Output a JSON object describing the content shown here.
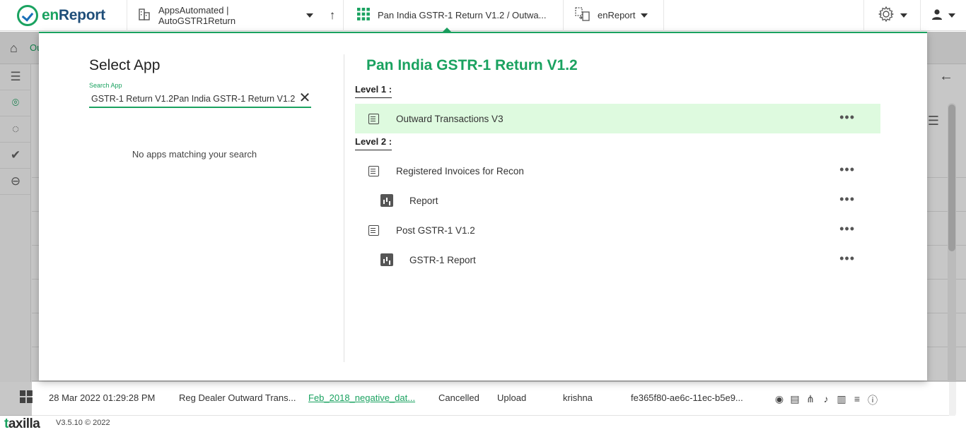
{
  "topbar": {
    "logo_prefix": "en",
    "logo_suffix": "Report",
    "entity_label": "AppsAutomated | AutoGSTR1Return",
    "up_arrow": "↑",
    "app_label": "Pan India GSTR-1 Return V1.2 / Outwa...",
    "report_label": "enReport"
  },
  "breadcrumb": {
    "text": "Ou"
  },
  "modal": {
    "title": "Select App",
    "search_label": "Search App",
    "search_value": "GSTR-1 Return V1.2Pan India GSTR-1 Return V1.2",
    "no_results": "No apps matching your search",
    "app_title": "Pan India GSTR-1 Return V1.2",
    "level1_label": "Level 1 :",
    "level2_label": "Level 2 :",
    "level1_items": [
      {
        "label": "Outward Transactions V3",
        "icon": "form-icon"
      }
    ],
    "level2_items": [
      {
        "label": "Registered Invoices for Recon",
        "icon": "form-icon"
      },
      {
        "label": "Report",
        "icon": "report-icon"
      },
      {
        "label": "Post GSTR-1 V1.2",
        "icon": "form-icon"
      },
      {
        "label": "GSTR-1 Report",
        "icon": "report-icon"
      }
    ]
  },
  "bg_row": {
    "date": "28 Mar 2022 01:29:28 PM",
    "type": "Reg Dealer Outward Trans...",
    "file": "Feb_2018_negative_dat...",
    "status": "Cancelled",
    "action": "Upload",
    "user": "krishna",
    "id": "fe365f80-ae6c-11ec-b5e9..."
  },
  "footer": {
    "logo_prefix": "t",
    "logo_suffix": "axilla",
    "version": "V3.5.10 © 2022"
  },
  "colors": {
    "accent": "#1aa260",
    "brand_dark": "#1f4e79",
    "active_row": "#defadf"
  }
}
